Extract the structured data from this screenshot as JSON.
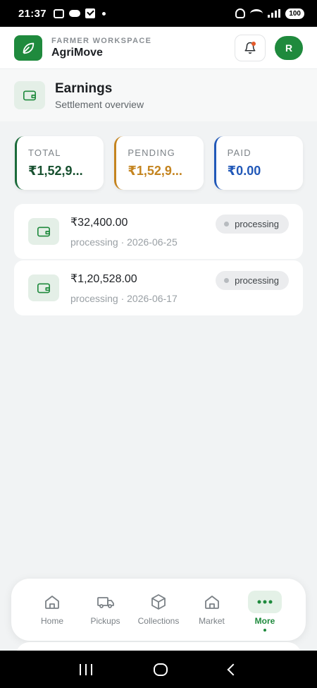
{
  "status_bar": {
    "time": "21:37",
    "battery": "100"
  },
  "header": {
    "workspace_label": "FARMER WORKSPACE",
    "app_name": "AgriMove",
    "avatar_initial": "R"
  },
  "page": {
    "title": "Earnings",
    "subtitle": "Settlement overview"
  },
  "summary": [
    {
      "label": "TOTAL",
      "value": "₹1,52,9..."
    },
    {
      "label": "PENDING",
      "value": "₹1,52,9..."
    },
    {
      "label": "PAID",
      "value": "₹0.00"
    }
  ],
  "settlements": [
    {
      "amount": "₹32,400.00",
      "meta": "processing · 2026-06-25",
      "status": "processing"
    },
    {
      "amount": "₹1,20,528.00",
      "meta": "processing · 2026-06-17",
      "status": "processing"
    }
  ],
  "nav": [
    {
      "label": "Home",
      "icon": "home-icon"
    },
    {
      "label": "Pickups",
      "icon": "truck-icon"
    },
    {
      "label": "Collections",
      "icon": "box-icon"
    },
    {
      "label": "Market",
      "icon": "store-icon"
    },
    {
      "label": "More",
      "icon": "more-icon",
      "active": true
    }
  ],
  "colors": {
    "brand": "#1f8a3d",
    "total": "#17502f",
    "pending": "#c4841f",
    "paid": "#2158b8"
  }
}
